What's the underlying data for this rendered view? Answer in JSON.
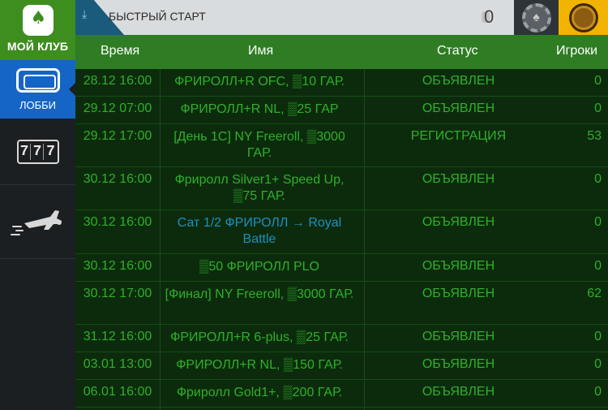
{
  "sidebar": {
    "club_label": "МОЙ КЛУБ",
    "lobby_label": "ЛОББИ",
    "slots_digits": [
      "7",
      "7",
      "7"
    ]
  },
  "topbar": {
    "quick_start_label": "БЫСТРЫЙ СТАРТ",
    "balance": "0"
  },
  "table": {
    "headers": {
      "time": "Время",
      "name": "Имя",
      "status": "Статус",
      "players": "Игроки"
    },
    "rows": [
      {
        "time": "28.12 16:00",
        "name": "ФРИРОЛЛ+R OFC, ▒10 ГАР.",
        "status": "ОБЪЯВЛЕН",
        "players": "0"
      },
      {
        "time": "29.12 07:00",
        "name": "ФРИРОЛЛ+R NL, ▒25 ГАР",
        "status": "ОБЪЯВЛЕН",
        "players": "0"
      },
      {
        "time": "29.12 17:00",
        "name": "[День 1C] NY Freeroll, ▒3000 ГАР.",
        "status": "РЕГИСТРАЦИЯ",
        "players": "53"
      },
      {
        "time": "30.12 16:00",
        "name": "Фриролл Silver1+ Speed Up, ▒75 ГАР.",
        "status": "ОБЪЯВЛЕН",
        "players": "0"
      },
      {
        "time": "30.12 16:00",
        "name": "Сат 1/2 ФРИРОЛЛ → Royal Battle",
        "status": "ОБЪЯВЛЕН",
        "players": "0"
      },
      {
        "time": "30.12 16:00",
        "name": "▒50 ФРИРОЛЛ PLO",
        "status": "ОБЪЯВЛЕН",
        "players": "0"
      },
      {
        "time": "30.12 17:00",
        "name": "[Финал] NY Freeroll, ▒3000 ГАР.",
        "status": "ОБЪЯВЛЕН",
        "players": "62"
      },
      {
        "time": "31.12 16:00",
        "name": "ФРИРОЛЛ+R 6-plus, ▒25 ГАР.",
        "status": "ОБЪЯВЛЕН",
        "players": "0"
      },
      {
        "time": "03.01 13:00",
        "name": "ФРИРОЛЛ+R NL, ▒150 ГАР.",
        "status": "ОБЪЯВЛЕН",
        "players": "0"
      },
      {
        "time": "06.01 16:00",
        "name": "Фриролл Gold1+, ▒200 ГАР.",
        "status": "ОБЪЯВЛЕН",
        "players": "0"
      }
    ]
  },
  "colors": {
    "header_green": "#2e7d23",
    "text_green": "#2fb02a",
    "link_blue": "#1e8fc0",
    "lobby_blue": "#1565c6",
    "club_green": "#3e8e1f",
    "coin_yellow": "#f2b300"
  },
  "icons": {
    "club": "spade-icon",
    "lobby": "lobby-icon",
    "slots": "slots-777-icon",
    "aviator": "airplane-icon",
    "quick_start": "download-icon",
    "chip": "poker-chip-icon",
    "coin": "coin-icon"
  }
}
